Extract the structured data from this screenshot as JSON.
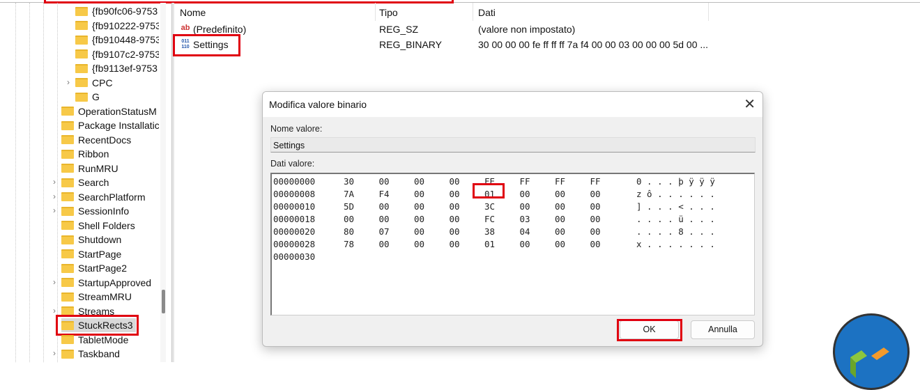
{
  "tree": {
    "items": [
      {
        "label": "{fb90fc06-9753",
        "level": 2,
        "expander": false
      },
      {
        "label": "{fb910222-9753",
        "level": 2,
        "expander": false
      },
      {
        "label": "{fb910448-9753",
        "level": 2,
        "expander": false
      },
      {
        "label": "{fb9107c2-9753",
        "level": 2,
        "expander": false
      },
      {
        "label": "{fb9113ef-9753",
        "level": 2,
        "expander": false
      },
      {
        "label": "CPC",
        "level": 2,
        "expander": true
      },
      {
        "label": "G",
        "level": 2,
        "expander": false
      },
      {
        "label": "OperationStatusM",
        "level": 1,
        "expander": false
      },
      {
        "label": "Package Installatic",
        "level": 1,
        "expander": false
      },
      {
        "label": "RecentDocs",
        "level": 1,
        "expander": false
      },
      {
        "label": "Ribbon",
        "level": 1,
        "expander": false
      },
      {
        "label": "RunMRU",
        "level": 1,
        "expander": false
      },
      {
        "label": "Search",
        "level": 1,
        "expander": true
      },
      {
        "label": "SearchPlatform",
        "level": 1,
        "expander": true
      },
      {
        "label": "SessionInfo",
        "level": 1,
        "expander": true
      },
      {
        "label": "Shell Folders",
        "level": 1,
        "expander": false
      },
      {
        "label": "Shutdown",
        "level": 1,
        "expander": false
      },
      {
        "label": "StartPage",
        "level": 1,
        "expander": false
      },
      {
        "label": "StartPage2",
        "level": 1,
        "expander": false
      },
      {
        "label": "StartupApproved",
        "level": 1,
        "expander": true
      },
      {
        "label": "StreamMRU",
        "level": 1,
        "expander": false
      },
      {
        "label": "Streams",
        "level": 1,
        "expander": true
      },
      {
        "label": "StuckRects3",
        "level": 1,
        "expander": false,
        "selected": true
      },
      {
        "label": "TabletMode",
        "level": 1,
        "expander": false
      },
      {
        "label": "Taskband",
        "level": 1,
        "expander": true
      }
    ]
  },
  "list": {
    "headers": {
      "name": "Nome",
      "type": "Tipo",
      "data": "Dati"
    },
    "rows": [
      {
        "icon": "string-value-icon",
        "icon_text": "ab",
        "name": "(Predefinito)",
        "type": "REG_SZ",
        "data": "(valore non impostato)"
      },
      {
        "icon": "binary-value-icon",
        "icon_text": "011\n110",
        "name": "Settings",
        "type": "REG_BINARY",
        "data": "30 00 00 00 fe ff ff ff 7a f4 00 00 03 00 00 00 5d 00 ..."
      }
    ]
  },
  "dialog": {
    "title": "Modifica valore binario",
    "name_label": "Nome valore:",
    "name_value": "Settings",
    "data_label": "Dati valore:",
    "hex_rows": [
      {
        "addr": "00000000",
        "bytes": [
          "30",
          "00",
          "00",
          "00",
          "FE",
          "FF",
          "FF",
          "FF"
        ],
        "ascii": "0 . . . þ ÿ ÿ ÿ"
      },
      {
        "addr": "00000008",
        "bytes": [
          "7A",
          "F4",
          "00",
          "00",
          "01",
          "00",
          "00",
          "00"
        ],
        "ascii": "z ô . . . . . ."
      },
      {
        "addr": "00000010",
        "bytes": [
          "5D",
          "00",
          "00",
          "00",
          "3C",
          "00",
          "00",
          "00"
        ],
        "ascii": "] . . . < . . ."
      },
      {
        "addr": "00000018",
        "bytes": [
          "00",
          "00",
          "00",
          "00",
          "FC",
          "03",
          "00",
          "00"
        ],
        "ascii": ". . . . ü . . ."
      },
      {
        "addr": "00000020",
        "bytes": [
          "80",
          "07",
          "00",
          "00",
          "38",
          "04",
          "00",
          "00"
        ],
        "ascii": ". . . . 8 . . ."
      },
      {
        "addr": "00000028",
        "bytes": [
          "78",
          "00",
          "00",
          "00",
          "01",
          "00",
          "00",
          "00"
        ],
        "ascii": "x . . . . . . ."
      },
      {
        "addr": "00000030",
        "bytes": [],
        "ascii": ""
      }
    ],
    "ok_label": "OK",
    "cancel_label": "Annulla"
  },
  "colors": {
    "highlight": "#e00010",
    "folder": "#f7c948",
    "logo_blue": "#1c72c2"
  }
}
